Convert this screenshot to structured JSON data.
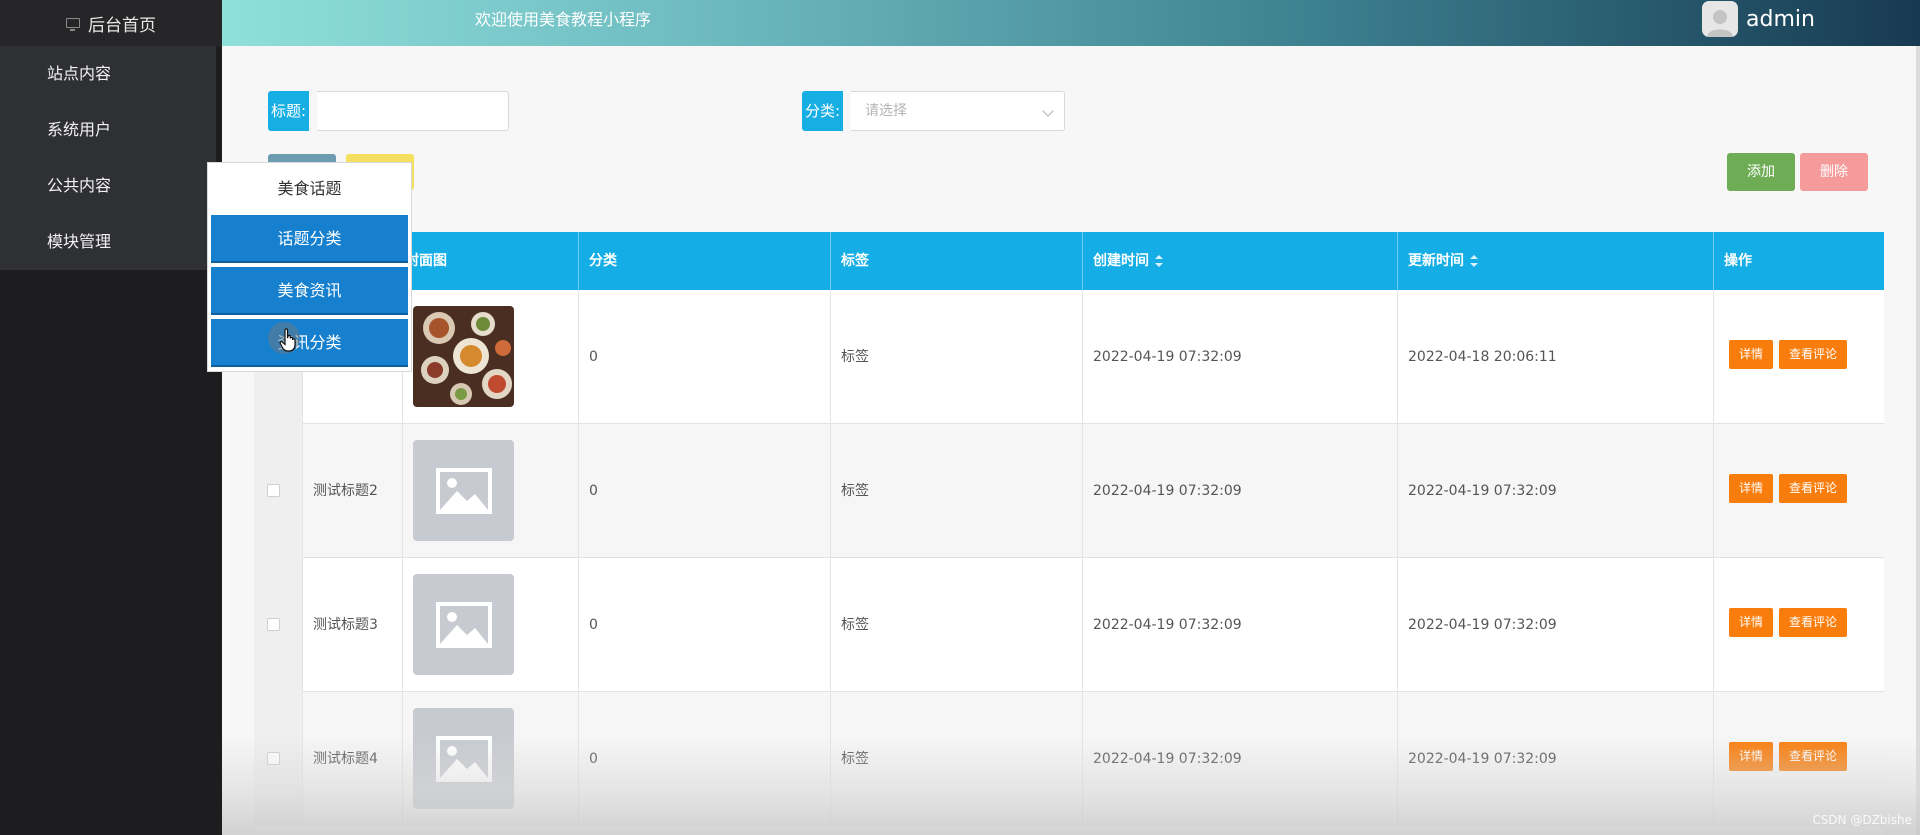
{
  "sidebar": {
    "home_label": "后台首页",
    "items": [
      {
        "label": "站点内容"
      },
      {
        "label": "系统用户"
      },
      {
        "label": "公共内容"
      },
      {
        "label": "模块管理"
      }
    ]
  },
  "header": {
    "welcome": "欢迎使用美食教程小程序",
    "username": "admin"
  },
  "filters": {
    "title_label": "标题:",
    "title_value": "",
    "category_label": "分类:",
    "category_placeholder": "请选择"
  },
  "actions": {
    "add_label": "添加",
    "delete_label": "删除"
  },
  "flyout": {
    "title": "美食话题",
    "items": [
      {
        "label": "话题分类"
      },
      {
        "label": "美食资讯"
      },
      {
        "label": "资讯分类"
      }
    ]
  },
  "table": {
    "columns": {
      "cover": "封面图",
      "category": "分类",
      "tags": "标签",
      "created": "创建时间",
      "updated": "更新时间",
      "ops": "操作"
    },
    "op_detail": "详情",
    "op_comments": "查看评论",
    "rows": [
      {
        "title": "",
        "cover": "food-photo",
        "category": "0",
        "tags": "标签",
        "created": "2022-04-19 07:32:09",
        "updated": "2022-04-18 20:06:11"
      },
      {
        "title": "测试标题2",
        "cover": "image-placeholder",
        "category": "0",
        "tags": "标签",
        "created": "2022-04-19 07:32:09",
        "updated": "2022-04-19 07:32:09"
      },
      {
        "title": "测试标题3",
        "cover": "image-placeholder",
        "category": "0",
        "tags": "标签",
        "created": "2022-04-19 07:32:09",
        "updated": "2022-04-19 07:32:09"
      },
      {
        "title": "测试标题4",
        "cover": "image-placeholder",
        "category": "0",
        "tags": "标签",
        "created": "2022-04-19 07:32:09",
        "updated": "2022-04-19 07:32:09"
      }
    ]
  },
  "watermark": "CSDN @DZbishe",
  "colors": {
    "header_label_blue": "#17aee3",
    "table_header": "#14ade5",
    "flyout_item": "#1680cf",
    "add_button": "#6ead55",
    "delete_button": "#f69b9b",
    "op_button": "#f97d0c"
  }
}
